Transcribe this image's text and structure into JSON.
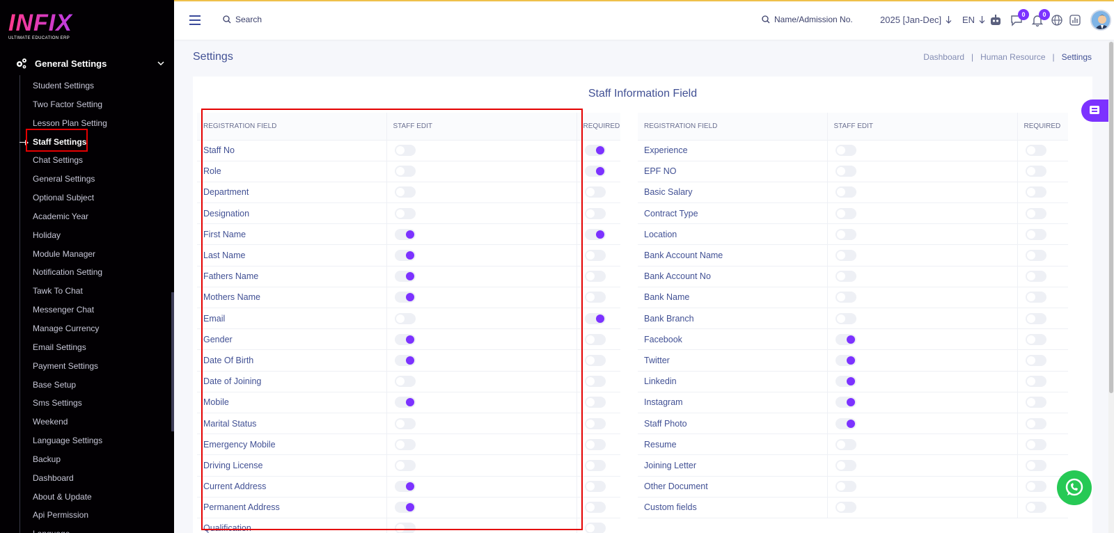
{
  "sidebar": {
    "logo_text": "INFIX",
    "logo_sub": "ULTIMATE EDUCATION ERP",
    "group_label": "General Settings",
    "items": [
      {
        "label": "Student Settings"
      },
      {
        "label": "Two Factor Setting"
      },
      {
        "label": "Lesson Plan Setting"
      },
      {
        "label": "Staff Settings",
        "active": true
      },
      {
        "label": "Chat Settings"
      },
      {
        "label": "General Settings"
      },
      {
        "label": "Optional Subject"
      },
      {
        "label": "Academic Year"
      },
      {
        "label": "Holiday"
      },
      {
        "label": "Module Manager"
      },
      {
        "label": "Notification Setting"
      },
      {
        "label": "Tawk To Chat"
      },
      {
        "label": "Messenger Chat"
      },
      {
        "label": "Manage Currency"
      },
      {
        "label": "Email Settings"
      },
      {
        "label": "Payment Settings"
      },
      {
        "label": "Base Setup"
      },
      {
        "label": "Sms Settings"
      },
      {
        "label": "Weekend"
      },
      {
        "label": "Language Settings"
      },
      {
        "label": "Backup"
      },
      {
        "label": "Dashboard"
      },
      {
        "label": "About & Update"
      },
      {
        "label": "Api Permission"
      },
      {
        "label": "Language"
      }
    ]
  },
  "header": {
    "search_label": "Search",
    "search2_label": "Name/Admission No.",
    "year": "2025 [Jan-Dec]",
    "lang": "EN",
    "msg_badge": "0",
    "notif_badge": "0"
  },
  "page": {
    "title": "Settings",
    "breadcrumb": [
      "Dashboard",
      "Human Resource",
      "Settings"
    ]
  },
  "card": {
    "title": "Staff Information Field",
    "headers": [
      "REGISTRATION FIELD",
      "STAFF EDIT",
      "REQUIRED"
    ],
    "left_rows": [
      {
        "field": "Staff No",
        "edit": false,
        "required": true
      },
      {
        "field": "Role",
        "edit": false,
        "required": true
      },
      {
        "field": "Department",
        "edit": false,
        "required": false
      },
      {
        "field": "Designation",
        "edit": false,
        "required": false
      },
      {
        "field": "First Name",
        "edit": true,
        "required": true
      },
      {
        "field": "Last Name",
        "edit": true,
        "required": false
      },
      {
        "field": "Fathers Name",
        "edit": true,
        "required": false
      },
      {
        "field": "Mothers Name",
        "edit": true,
        "required": false
      },
      {
        "field": "Email",
        "edit": false,
        "required": true
      },
      {
        "field": "Gender",
        "edit": true,
        "required": false
      },
      {
        "field": "Date Of Birth",
        "edit": true,
        "required": false
      },
      {
        "field": "Date of Joining",
        "edit": false,
        "required": false
      },
      {
        "field": "Mobile",
        "edit": true,
        "required": false
      },
      {
        "field": "Marital Status",
        "edit": false,
        "required": false
      },
      {
        "field": "Emergency Mobile",
        "edit": false,
        "required": false
      },
      {
        "field": "Driving License",
        "edit": false,
        "required": false
      },
      {
        "field": "Current Address",
        "edit": true,
        "required": false
      },
      {
        "field": "Permanent Address",
        "edit": true,
        "required": false
      },
      {
        "field": "Qualification",
        "edit": false,
        "required": false
      }
    ],
    "right_rows": [
      {
        "field": "Experience",
        "edit": false,
        "required": false
      },
      {
        "field": "EPF NO",
        "edit": false,
        "required": false
      },
      {
        "field": "Basic Salary",
        "edit": false,
        "required": false
      },
      {
        "field": "Contract Type",
        "edit": false,
        "required": false
      },
      {
        "field": "Location",
        "edit": false,
        "required": false
      },
      {
        "field": "Bank Account Name",
        "edit": false,
        "required": false
      },
      {
        "field": "Bank Account No",
        "edit": false,
        "required": false
      },
      {
        "field": "Bank Name",
        "edit": false,
        "required": false
      },
      {
        "field": "Bank Branch",
        "edit": false,
        "required": false
      },
      {
        "field": "Facebook",
        "edit": true,
        "required": false
      },
      {
        "field": "Twitter",
        "edit": true,
        "required": false
      },
      {
        "field": "Linkedin",
        "edit": true,
        "required": false
      },
      {
        "field": "Instagram",
        "edit": true,
        "required": false
      },
      {
        "field": "Staff Photo",
        "edit": true,
        "required": false
      },
      {
        "field": "Resume",
        "edit": false,
        "required": false
      },
      {
        "field": "Joining Letter",
        "edit": false,
        "required": false
      },
      {
        "field": "Other Document",
        "edit": false,
        "required": false
      },
      {
        "field": "Custom fields",
        "edit": false,
        "required": false
      }
    ]
  },
  "icons": {
    "menu": "hamburger-icon",
    "search": "search-icon",
    "bot": "robot-icon",
    "chat": "chat-icon",
    "bell": "bell-icon",
    "globe": "globe-icon",
    "chart": "chart-icon",
    "cart": "cart-icon",
    "whatsapp": "whatsapp-icon"
  },
  "colors": {
    "accent": "#7c32ff",
    "sidebar_bg": "#020003",
    "highlight": "#e40000",
    "whatsapp": "#26c955"
  }
}
